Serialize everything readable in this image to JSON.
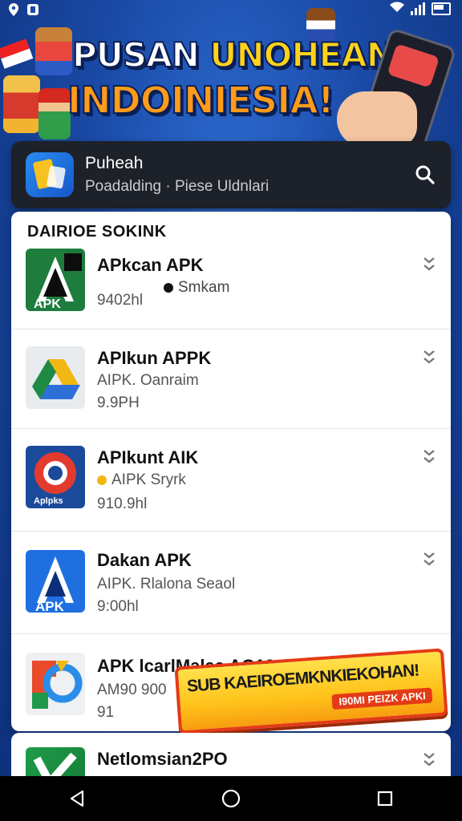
{
  "banner": {
    "title_word1": "PUSAN",
    "title_word2": "UNOHEAN",
    "title_line2": "INDOINIESIA!"
  },
  "search_panel": {
    "title": "Puheah",
    "subtitle": "Poadalding · Piese Uldnlari",
    "icon": "search-icon"
  },
  "list": {
    "header": "DAIRIOE SOKINK",
    "items": [
      {
        "name": "APkcan APK",
        "meta": "Smkam",
        "size": "940​2hl",
        "icon_colors": [
          "#1e7d3c",
          "#0d0d0d"
        ]
      },
      {
        "name": "APIkun APPK",
        "meta": "AIPK. Oanraim",
        "size": "9.9PH",
        "icon_colors": [
          "#f2b712",
          "#1f8a45"
        ]
      },
      {
        "name": "APIkunt AIK",
        "meta": "AIPK Sryrk",
        "size": "910.9hl",
        "icon_colors": [
          "#e23b2e",
          "#1c4a9b"
        ]
      },
      {
        "name": "Dakan APK",
        "meta": "AIPK. Rlalona Seaol",
        "size": "9:00hl",
        "icon_colors": [
          "#1f6fe0",
          "#ffffff"
        ]
      },
      {
        "name": "APK lcarlMalaa AG19",
        "meta": "AM90 900",
        "size": "91",
        "icon_colors": [
          "#e84a2a",
          "#2a8de8"
        ]
      }
    ],
    "next_item": {
      "name": "Netlomsian2PO"
    }
  },
  "promo": {
    "line1": "SUB KAEIROEMKNKIEKOHAN!",
    "line2": "I90MI PEIZK APKI"
  },
  "navbar": {
    "back": "back-icon",
    "home": "home-icon",
    "recents": "recents-icon"
  },
  "colors": {
    "accent": "#1d2129",
    "banner_yellow": "#ffd21a",
    "banner_orange": "#ff9b1a",
    "promo_red": "#e43a16"
  }
}
